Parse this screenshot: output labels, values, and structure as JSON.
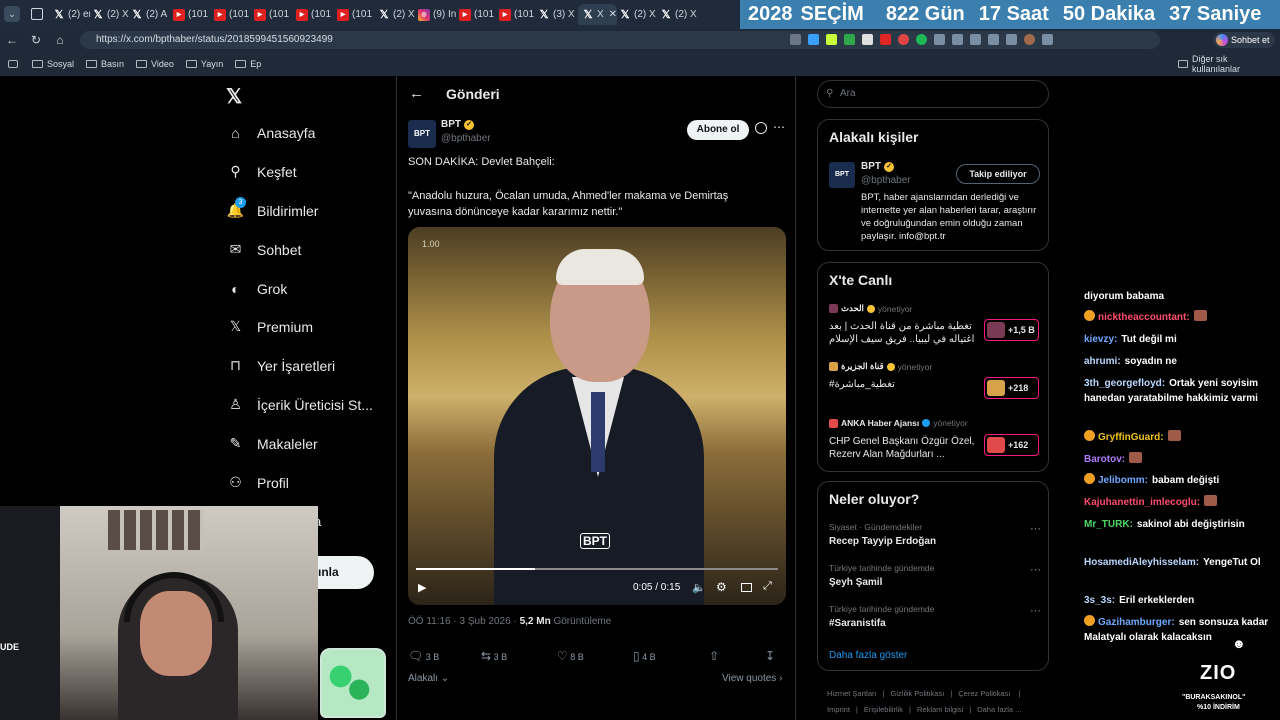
{
  "browser": {
    "tabs": [
      {
        "icon": "x",
        "label": "(2) er"
      },
      {
        "icon": "x",
        "label": "(2) X"
      },
      {
        "icon": "x",
        "label": "(2) A"
      },
      {
        "icon": "yt",
        "label": "(101"
      },
      {
        "icon": "yt",
        "label": "(101"
      },
      {
        "icon": "yt",
        "label": "(101"
      },
      {
        "icon": "yt",
        "label": "(101"
      },
      {
        "icon": "yt",
        "label": "(101"
      },
      {
        "icon": "x",
        "label": "(2) X"
      },
      {
        "icon": "ig",
        "label": "(9) In"
      },
      {
        "icon": "yt",
        "label": "(101"
      },
      {
        "icon": "yt",
        "label": "(101"
      },
      {
        "icon": "x",
        "label": "(3) X"
      },
      {
        "icon": "x",
        "label": "X"
      },
      {
        "icon": "x",
        "label": "(2) X"
      },
      {
        "icon": "x",
        "label": "(2) X"
      }
    ],
    "url": "https://x.com/bpthaber/status/2018599451560923499",
    "chat_button": "Sohbet et",
    "bookmarks": [
      "Sosyal",
      "Basın",
      "Video",
      "Yayın",
      "Ep"
    ],
    "other_bookmarks": "Diğer sık kullanılanlar"
  },
  "countdown": {
    "year": "2028",
    "label": "SEÇİM",
    "days": "822 Gün",
    "hours": "17 Saat",
    "minutes": "50 Dakika",
    "seconds": "37 Saniye"
  },
  "nav": {
    "items": [
      {
        "label": "Anasayfa",
        "icon": "home-icon"
      },
      {
        "label": "Keşfet",
        "icon": "search-icon"
      },
      {
        "label": "Bildirimler",
        "icon": "bell-icon",
        "badge": "3"
      },
      {
        "label": "Sohbet",
        "icon": "mail-icon"
      },
      {
        "label": "Grok",
        "icon": "grok-icon"
      },
      {
        "label": "Premium",
        "icon": "x-icon"
      },
      {
        "label": "Yer İşaretleri",
        "icon": "bookmark-icon"
      },
      {
        "label": "İçerik Üreticisi St...",
        "icon": "creator-icon"
      },
      {
        "label": "Makaleler",
        "icon": "article-icon"
      },
      {
        "label": "Profil",
        "icon": "person-icon"
      }
    ],
    "more_fragment": "a",
    "post_button_fragment": "ınla"
  },
  "post": {
    "header": "Gönderi",
    "author": "BPT",
    "handle": "@bpthaber",
    "subscribe": "Abone ol",
    "line1": "SON DAKİKA: Devlet Bahçeli:",
    "line2": "\"Anadolu huzura, Öcalan umuda, Ahmed'ler makama ve Demirtaş yuvasına dönünceye kadar kararımız nettir.\"",
    "video": {
      "speed": "1.00",
      "time": "0:05 / 0:15",
      "watermark": "BPT",
      "progress": 0.33
    },
    "date": "ÖÖ 11:16 · 3 Şub 2026 ·",
    "views": "5,2 Mn",
    "views_label": "Görüntüleme",
    "replies": "3 B",
    "reposts": "3 B",
    "likes": "8 B",
    "bookmarks": "4 B",
    "related": "Alakalı",
    "quotes": "View quotes"
  },
  "search": {
    "placeholder": "Ara"
  },
  "related_people": {
    "title": "Alakalı kişiler",
    "name": "BPT",
    "handle": "@bpthaber",
    "follow": "Takip ediliyor",
    "bio": "BPT, haber ajanslarından derlediği ve internette yer alan haberleri tarar, araştırır ve doğruluğundan emin olduğu zaman paylaşır. info@bpt.tr"
  },
  "live": {
    "title": "X'te Canlı",
    "items": [
      {
        "host": "الحدث",
        "status": "yönetiyor",
        "text": "تغطية مباشرة من قناة الحدث | بعد اغتياله في ليبيا.. فريق سيف الإسلام",
        "count": "+1,5 B"
      },
      {
        "host": "قناة الجزيرة",
        "status": "yönetiyor",
        "text": "#تغطية_مباشرة",
        "count": "+218"
      },
      {
        "host": "ANKA Haber Ajansı",
        "status": "yönetiyor",
        "text": "CHP Genel Başkanı Özgür Özel, Rezerv Alan Mağdurları ...",
        "count": "+162"
      }
    ]
  },
  "trends": {
    "title": "Neler oluyor?",
    "items": [
      {
        "context": "Siyaset · Gündemdekiler",
        "name": "Recep Tayyip Erdoğan"
      },
      {
        "context": "Türkiye tarihinde gündemde",
        "name": "Şeyh Şamil"
      },
      {
        "context": "Türkiye tarihinde gündemde",
        "name": "#Saranistifa"
      }
    ],
    "more": "Daha fazla göster"
  },
  "footer": {
    "links": [
      "Hizmet Şartları",
      "Gizlilik Politikası",
      "Çerez Politikası",
      "Imprint",
      "Erişilebilirlik",
      "Reklam bilgisi",
      "Daha fazla ..."
    ]
  },
  "chat": {
    "messages": [
      {
        "user": "",
        "text": "diyorum babama",
        "color": "#ffffff"
      },
      {
        "user": "nicktheaccountant:",
        "text": "",
        "color": "#ff4d6d"
      },
      {
        "user": "kievzy:",
        "text": "Tut değil mi",
        "color": "#6fa8ff"
      },
      {
        "user": "ahrumi:",
        "text": "soyadın ne",
        "color": "#b9d7ff"
      },
      {
        "user": "3th_georgefloyd:",
        "text": "Ortak yeni soyisim hanedan yaratabilme hakkimiz varmi",
        "color": "#b9d7ff"
      },
      {
        "user": "GryffinGuard:",
        "text": "",
        "color": "#f0c419"
      },
      {
        "user": "Barotov:",
        "text": "",
        "color": "#b07cff"
      },
      {
        "user": "Jelibomm:",
        "text": "babam değişti",
        "color": "#6fa8ff"
      },
      {
        "user": "Kajuhanettin_imlecoglu:",
        "text": "",
        "color": "#ff4d6d"
      },
      {
        "user": "Mr_TURK:",
        "text": "sakinol abi değiştirisin",
        "color": "#4cd964"
      },
      {
        "user": "HosamediAleyhisselam:",
        "text": "YengeTut Ol",
        "color": "#b9d7ff"
      },
      {
        "user": "3s_3s:",
        "text": "Eril erkeklerden",
        "color": "#b9d7ff"
      },
      {
        "user": "Gazihamburger:",
        "text": "sen sonsuza kadar Malatyalı olarak kalacaksın",
        "color": "#6fa8ff"
      }
    ]
  },
  "overlay": {
    "logo": "ZIO",
    "promo": "\"BURAKSAKINOL\"",
    "discount": "%10 İNDİRİM",
    "cam_label": "UDE"
  },
  "colors": {
    "accent": "#1d9bf0",
    "countdown_bg": "#3a7fae",
    "live_border": "#f91880",
    "verified": "#f7c331"
  }
}
